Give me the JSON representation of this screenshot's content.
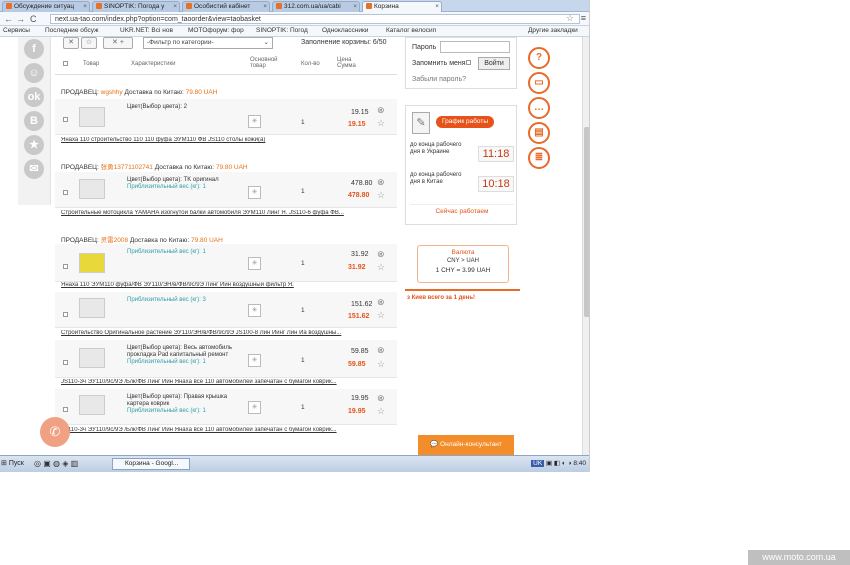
{
  "browser": {
    "tabs": [
      "Обсуждение ситуац",
      "SINOPTIK: Погода у",
      "Особистий кабінет",
      "312.com.ua/ua/cabi",
      "Корзина"
    ],
    "url": "next.ua-tao.com/index.php?option=com_taoorder&view=taobasket",
    "bookmarks": [
      "Сервисы",
      "Последние обсуж",
      "UKR.NET: Всі нов",
      "MOTOфорум: фор",
      "SINOPTIK: Погод",
      "Одноклассники",
      "Каталог велосип",
      "Другие закладки"
    ]
  },
  "basket": {
    "filter_placeholder": "-Фильтр по категории-",
    "fill_label": "Заполнение корзины: 6/50",
    "headers": {
      "product": "Товар",
      "chars": "Характеристики",
      "main": "Основной товар",
      "qty": "Кол-во",
      "price": "Цена Сумма"
    },
    "sellers": [
      {
        "label": "ПРОДАВЕЦ:",
        "name": "wgshhy",
        "delivery": "Доставка по Китаю:",
        "price": "79.80 UAH"
      },
      {
        "label": "ПРОДАВЕЦ:",
        "name": "张勇13771102741",
        "delivery": "Доставка по Китаю:",
        "price": "79.80 UAH"
      },
      {
        "label": "ПРОДАВЕЦ:",
        "name": "灵雷2008",
        "delivery": "Доставка по Китаю:",
        "price": "79.80 UAH"
      }
    ],
    "items": [
      {
        "chars": "Цвет(Выбор цвета): 2",
        "weight": "",
        "qty": "1",
        "price": "19.15",
        "sum": "19.15",
        "title": "Янаха 110 строительство 110 110 фуфа ЭУМ110 ФВ JS110 столы кожи(а)"
      },
      {
        "chars": "Цвет(Выбор цвета): TK оригинал",
        "weight": "Приблизительный вес (кг): 1",
        "qty": "1",
        "price": "478.80",
        "sum": "478.80",
        "title": "Строительные мотоцикла YAMAHA изогнутой балки автомобиля ЭУМ110 Линг Я. JS110-6 фуфа ФВ..."
      },
      {
        "chars": "",
        "weight": "Приблизительный вес (кг): 1",
        "qty": "1",
        "price": "31.92",
        "sum": "31.92",
        "title": "Янаха 110 ЭУМ110 фуфа/ФВ ЭУ110/ЭН/в/ФВ/9с/9Э Линг Йин воздушный фильтр Я."
      },
      {
        "chars": "",
        "weight": "Приблизительный вес (кг): 3",
        "qty": "1",
        "price": "151.62",
        "sum": "151.62",
        "title": "Строительство Оригинальное растение ЭУ110/ЭН/в/ФВ/9с/9Э JS100-8 Лин Йинг Лин Йа воздушны..."
      },
      {
        "chars": "Цвет(Выбор цвета): Весь автомобиль прокладка Pad капитальный ремонт",
        "weight": "Приблизительный вес (кг): 1",
        "qty": "1",
        "price": "59.85",
        "sum": "59.85",
        "title": "JS110-3ч ЭУ110/9с/9Э /Б/ж/ФВ Линг Йин Янаха все 110 автомобилей запечатан с бумагой коврик..."
      },
      {
        "chars": "Цвет(Выбор цвета): Правая крышка картера коврик",
        "weight": "Приблизительный вес (кг): 1",
        "qty": "1",
        "price": "19.95",
        "sum": "19.95",
        "title": "JS110-3ч ЭУ110/9с/9Э /Б/ж/ФВ Линг Йин Янаха все 110 автомобилей запечатан с бумагой коврик..."
      }
    ]
  },
  "sidebar": {
    "password_label": "Пароль",
    "remember_label": "Запомнить меня",
    "login_button": "Войти",
    "forgot_label": "Забыли пароль?",
    "schedule_button": "График работы",
    "ukraine_label": "до конца рабочего дня в Украине",
    "ukraine_time": "11:18",
    "china_label": "до конца рабочего дня в Китае",
    "china_time": "10:18",
    "working_label": "Сейчас работаем",
    "currency_title": "Валюта",
    "currency_pair": "CNY > UAH",
    "currency_rate": "1 CHY = 3.99 UAH",
    "promo": "з Киев всего за 1 день!",
    "chat_button": "Онлайн-консультант"
  },
  "taskbar": {
    "start": "Пуск",
    "task": "Корзина - Googl...",
    "lang": "UK",
    "clock": "8:40"
  },
  "watermark": "www.moto.com.ua"
}
